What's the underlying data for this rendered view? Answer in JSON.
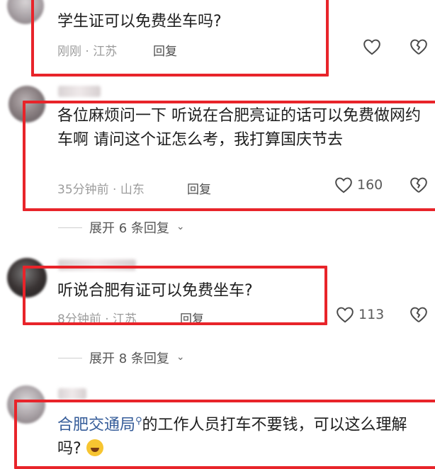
{
  "comments": [
    {
      "text": "学生证可以免费坐车吗?",
      "time": "刚刚",
      "location": "江苏",
      "reply_label": "回复",
      "like_count": ""
    },
    {
      "text": "各位麻烦问一下 听说在合肥亮证的话可以免费做网约车啊 请问这个证怎么考，我打算国庆节去",
      "time": "35分钟前",
      "location": "山东",
      "reply_label": "回复",
      "like_count": "160",
      "expand_label": "展开 6 条回复"
    },
    {
      "text": "听说合肥有证可以免费坐车?",
      "time": "8分钟前",
      "location": "江苏",
      "reply_label": "回复",
      "like_count": "113",
      "expand_label": "展开 8 条回复"
    },
    {
      "link_text": "合肥交通局",
      "text_rest": "的工作人员打车不要钱，可以这么理解吗?",
      "emoji": "grinning-sweat-emoji"
    }
  ],
  "meta_separator": "·",
  "icons": {
    "like": "heart-outline-icon",
    "dislike": "broken-heart-icon",
    "expand": "chevron-down-icon",
    "search_mark": "search-icon"
  },
  "colors": {
    "highlight_box": "#e8242a",
    "link": "#355c99",
    "meta_text": "#9c9c9c"
  }
}
